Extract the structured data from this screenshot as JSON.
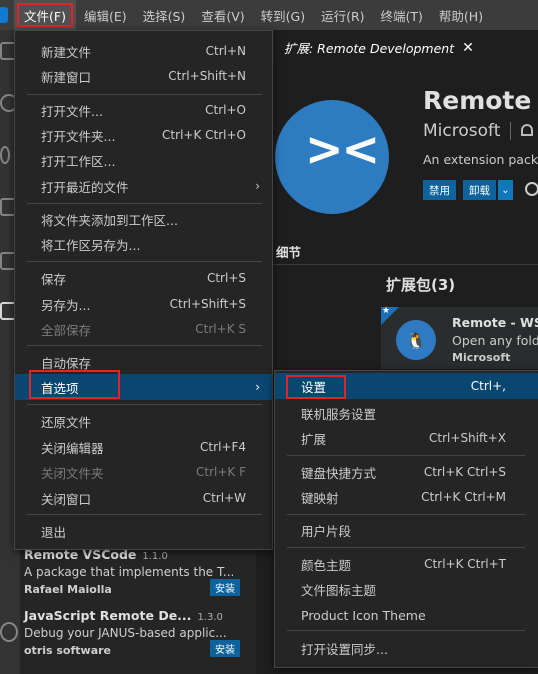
{
  "menubar": {
    "items": [
      "文件(F)",
      "编辑(E)",
      "选择(S)",
      "查看(V)",
      "转到(G)",
      "运行(R)",
      "终端(T)",
      "帮助(H)"
    ]
  },
  "tab": {
    "title": "扩展: Remote Development",
    "close": "✕"
  },
  "extension": {
    "logo": "><",
    "name": "Remote D",
    "publisher": "Microsoft",
    "description": "An extension pack",
    "disable_label": "禁用",
    "uninstall_label": "卸载",
    "caret": "⌄",
    "details_tab": "细节",
    "pack_title": "扩展包(3)",
    "pack": {
      "star": "★",
      "name": "Remote - WSL",
      "description": "Open any folde",
      "publisher": "Microsoft"
    }
  },
  "sidebar_list": [
    {
      "title": "Remote VSCode",
      "version": "1.1.0",
      "description": "A package that implements the T...",
      "publisher": "Rafael Maiolla",
      "install": "安装"
    },
    {
      "title": "JavaScript Remote De...",
      "version": "1.3.0",
      "description": "Debug your JANUS-based applic...",
      "publisher": "otris software",
      "install": "安装"
    }
  ],
  "file_menu": {
    "items": [
      {
        "label": "新建文件",
        "key": "Ctrl+N"
      },
      {
        "label": "新建窗口",
        "key": "Ctrl+Shift+N"
      },
      {
        "label": "打开文件...",
        "key": "Ctrl+O"
      },
      {
        "label": "打开文件夹...",
        "key": "Ctrl+K Ctrl+O"
      },
      {
        "label": "打开工作区...",
        "key": ""
      },
      {
        "label": "打开最近的文件",
        "key": ""
      },
      {
        "label": "将文件夹添加到工作区...",
        "key": ""
      },
      {
        "label": "将工作区另存为...",
        "key": ""
      },
      {
        "label": "保存",
        "key": "Ctrl+S"
      },
      {
        "label": "另存为...",
        "key": "Ctrl+Shift+S"
      },
      {
        "label": "全部保存",
        "key": "Ctrl+K S"
      },
      {
        "label": "自动保存",
        "key": ""
      },
      {
        "label": "首选项",
        "key": ""
      },
      {
        "label": "还原文件",
        "key": ""
      },
      {
        "label": "关闭编辑器",
        "key": "Ctrl+F4"
      },
      {
        "label": "关闭文件夹",
        "key": "Ctrl+K F"
      },
      {
        "label": "关闭窗口",
        "key": "Ctrl+W"
      },
      {
        "label": "退出",
        "key": ""
      }
    ],
    "submenu_chevron": "›"
  },
  "prefs_menu": {
    "items": [
      {
        "label": "设置",
        "key": "Ctrl+,"
      },
      {
        "label": "联机服务设置",
        "key": ""
      },
      {
        "label": "扩展",
        "key": "Ctrl+Shift+X"
      },
      {
        "label": "键盘快捷方式",
        "key": "Ctrl+K Ctrl+S"
      },
      {
        "label": "键映射",
        "key": "Ctrl+K Ctrl+M"
      },
      {
        "label": "用户片段",
        "key": ""
      },
      {
        "label": "颜色主题",
        "key": "Ctrl+K Ctrl+T"
      },
      {
        "label": "文件图标主题",
        "key": ""
      },
      {
        "label": "Product Icon Theme",
        "key": ""
      },
      {
        "label": "打开设置同步...",
        "key": ""
      }
    ]
  },
  "colors": {
    "highlight": "#094771",
    "accent_red": "#e0242a",
    "button_blue": "#0e639c"
  }
}
